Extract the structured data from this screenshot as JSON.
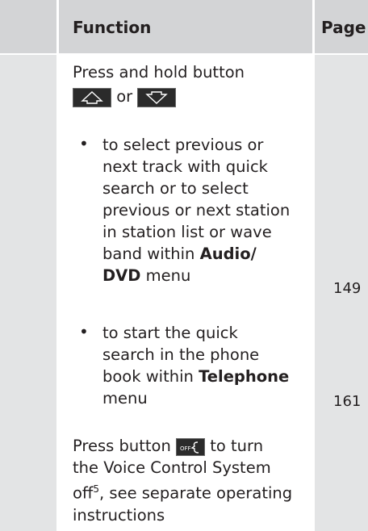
{
  "header": {
    "function_label": "Function",
    "page_label": "Page"
  },
  "rows": {
    "intro_line1": "Press and hold button",
    "intro_or": "or",
    "bullet1": {
      "symbol": "•",
      "line1": "to select previous or",
      "line2": "next track with quick",
      "line3": "search or to select",
      "line4": "previous or next station",
      "line5": "in station list or wave",
      "line6_pre": "band within ",
      "line6_bold": "Audio/",
      "line7_bold": "DVD",
      "line7_post": " menu",
      "page": "149"
    },
    "bullet2": {
      "symbol": "•",
      "line1": "to start the quick",
      "line2": "search in the phone",
      "line3_pre": "book within ",
      "line3_bold": "Telephone",
      "line4": "menu",
      "page": "161"
    },
    "press_pre": "Press button",
    "press_post": "to turn",
    "press_line2": "the Voice Control System",
    "press_line3_pre": "off",
    "press_line3_sup": "5",
    "press_line3_post": ", see separate operating",
    "press_line4": "instructions",
    "off_button_label": "OFF"
  },
  "icons": {
    "up": "arrow-up-icon",
    "down": "arrow-down-icon",
    "voice_off": "voice-off-icon"
  }
}
